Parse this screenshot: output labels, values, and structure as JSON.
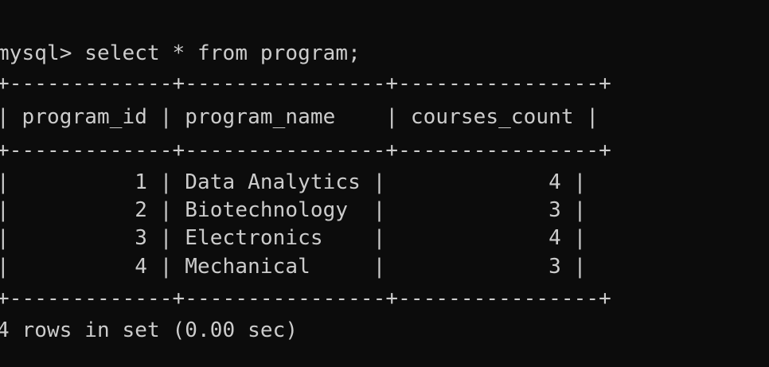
{
  "terminal": {
    "prompt": "mysql> select * from program;",
    "border": "+-------------+----------------+----------------+",
    "header": "| program_id | program_name    | courses_count |",
    "columns": [
      "program_id",
      "program_name",
      "courses_count"
    ],
    "rows": [
      {
        "text": "|          1 | Data Analytics |             4 |",
        "program_id": "1",
        "program_name": "Data Analytics",
        "courses_count": "4"
      },
      {
        "text": "|          2 | Biotechnology  |             3 |",
        "program_id": "2",
        "program_name": "Biotechnology",
        "courses_count": "3"
      },
      {
        "text": "|          3 | Electronics    |             4 |",
        "program_id": "3",
        "program_name": "Electronics",
        "courses_count": "4"
      },
      {
        "text": "|          4 | Mechanical     |             3 |",
        "program_id": "4",
        "program_name": "Mechanical",
        "courses_count": "3"
      }
    ],
    "result_summary": "4 rows in set (0.00 sec)",
    "colors": {
      "background": "#0c0c0c",
      "foreground": "#cccccc"
    }
  }
}
